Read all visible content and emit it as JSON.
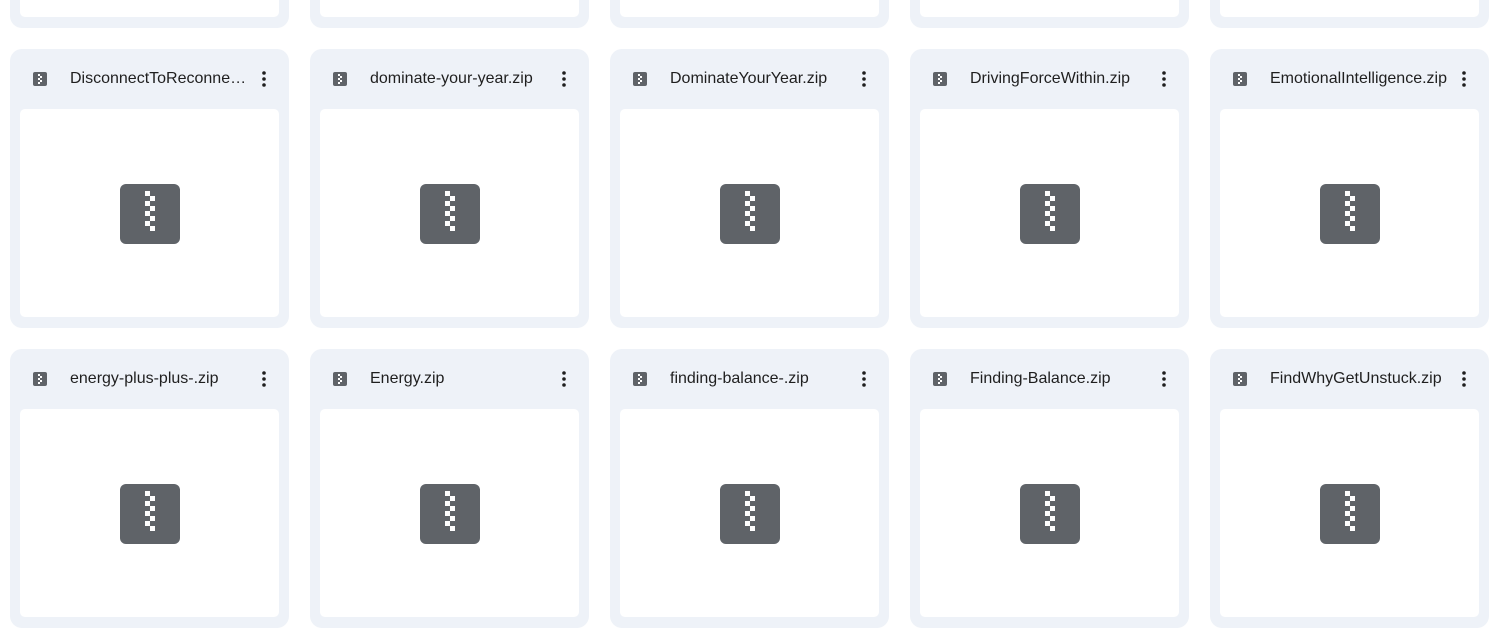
{
  "theme": {
    "card_bg": "#eef2f8",
    "icon_color": "#5f6368",
    "text_color": "#1f1f1f"
  },
  "icons": {
    "file_type": "zip-archive-icon",
    "menu": "more-vert-icon"
  },
  "files": [
    {
      "name": ""
    },
    {
      "name": ""
    },
    {
      "name": ""
    },
    {
      "name": ""
    },
    {
      "name": ""
    },
    {
      "name": "DisconnectToReconnect.zip"
    },
    {
      "name": "dominate-your-year.zip"
    },
    {
      "name": "DominateYourYear.zip"
    },
    {
      "name": "DrivingForceWithin.zip"
    },
    {
      "name": "EmotionalIntelligence.zip"
    },
    {
      "name": "energy-plus-plus-.zip"
    },
    {
      "name": "Energy.zip"
    },
    {
      "name": "finding-balance-.zip"
    },
    {
      "name": "Finding-Balance.zip"
    },
    {
      "name": "FindWhyGetUnstuck.zip"
    }
  ]
}
